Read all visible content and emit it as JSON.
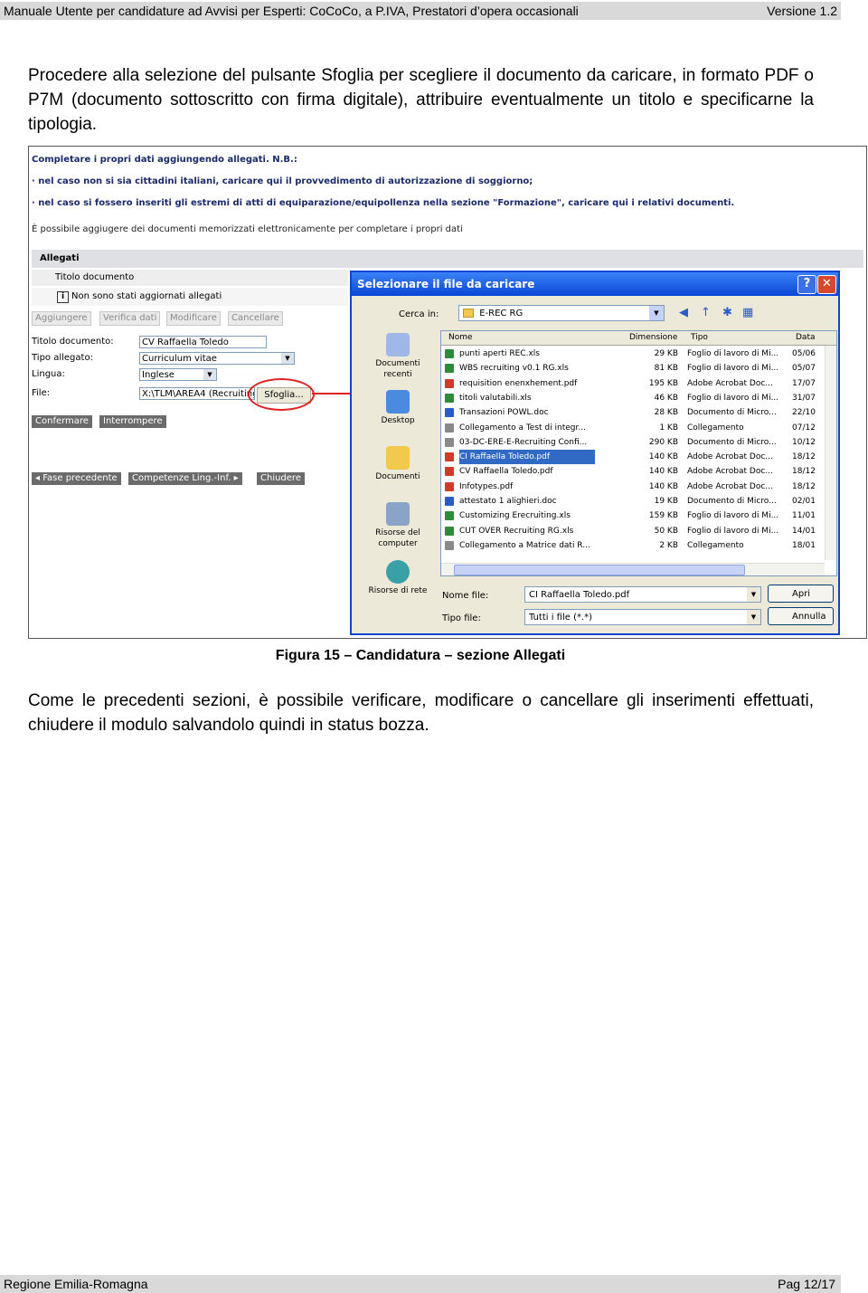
{
  "header": {
    "title": "Manuale Utente per candidature ad Avvisi per Esperti: CoCoCo, a P.IVA, Prestatori d’opera occasionali",
    "version": "Versione  1.2"
  },
  "intro_paragraph": "Procedere alla selezione del pulsante  Sfoglia  per scegliere il documento da caricare, in formato PDF o P7M (documento sottoscritto con firma digitale), attribuire eventualmente un titolo e specificarne la tipologia.",
  "figure": {
    "notes": {
      "line1": "Completare i propri dati aggiungendo allegati. N.B.:",
      "line2": "· nel caso non si sia cittadini italiani, caricare qui il provvedimento di autorizzazione di soggiorno;",
      "line3": "· nel caso si fossero inseriti gli estremi di atti di equiparazione/equipollenza nella sezione \"Formazione\", caricare qui i relativi documenti.",
      "line4": "È possibile aggiugere dei documenti memorizzati elettronicamente per completare i propri dati"
    },
    "section_title": "Allegati",
    "column_title": "Titolo documento",
    "info_message": "Non sono stati aggiornati allegati",
    "action_buttons": {
      "add": "Aggiungere",
      "verify": "Verifica dati",
      "modify": "Modificare",
      "delete": "Cancellare"
    },
    "form": {
      "title_label": "Titolo documento:",
      "title_value": "CV Raffaella Toledo",
      "type_label": "Tipo allegato:",
      "type_value": "Curriculum vitae",
      "language_label": "Lingua:",
      "language_value": "Inglese",
      "file_label": "File:",
      "file_value": "X:\\TLM\\AREA4 (Recruiting",
      "browse_button": "Sfoglia..."
    },
    "confirm_button": "Confermare",
    "interrupt_button": "Interrompere",
    "nav": {
      "prev": "Fase precedente",
      "next": "Competenze Ling.-Inf.",
      "close": "Chiudere"
    },
    "dialog": {
      "title": "Selezionare il file da caricare",
      "lookin_label": "Cerca in:",
      "lookin_value": "E-REC RG",
      "places": {
        "recent": "Documenti recenti",
        "desktop": "Desktop",
        "documents": "Documenti",
        "computer": "Risorse del computer",
        "network": "Risorse di rete"
      },
      "columns": {
        "name": "Nome",
        "size": "Dimensione",
        "type": "Tipo",
        "date": "Data"
      },
      "files": [
        {
          "name": "punti aperti REC.xls",
          "size": "29 KB",
          "type": "Foglio di lavoro di Mi...",
          "date": "05/06"
        },
        {
          "name": "WBS recruiting v0.1 RG.xls",
          "size": "81 KB",
          "type": "Foglio di lavoro di Mi...",
          "date": "05/07"
        },
        {
          "name": "requisition enenxhement.pdf",
          "size": "195 KB",
          "type": "Adobe Acrobat Doc...",
          "date": "17/07"
        },
        {
          "name": "titoli valutabili.xls",
          "size": "46 KB",
          "type": "Foglio di lavoro di Mi...",
          "date": "31/07"
        },
        {
          "name": "Transazioni POWL.doc",
          "size": "28 KB",
          "type": "Documento di Micro...",
          "date": "22/10"
        },
        {
          "name": "Collegamento a Test di integr...",
          "size": "1 KB",
          "type": "Collegamento",
          "date": "07/12"
        },
        {
          "name": "03-DC-ERE-E-Recruiting Confi...",
          "size": "290 KB",
          "type": "Documento di Micro...",
          "date": "10/12"
        },
        {
          "name": "CI Raffaella Toledo.pdf",
          "size": "140 KB",
          "type": "Adobe Acrobat Doc...",
          "date": "18/12"
        },
        {
          "name": "CV Raffaella Toledo.pdf",
          "size": "140 KB",
          "type": "Adobe Acrobat Doc...",
          "date": "18/12"
        },
        {
          "name": "Infotypes.pdf",
          "size": "140 KB",
          "type": "Adobe Acrobat Doc...",
          "date": "18/12"
        },
        {
          "name": "attestato 1 alighieri.doc",
          "size": "19 KB",
          "type": "Documento di Micro...",
          "date": "02/01"
        },
        {
          "name": "Customizing Erecruiting.xls",
          "size": "159 KB",
          "type": "Foglio di lavoro di Mi...",
          "date": "11/01"
        },
        {
          "name": "CUT OVER Recruiting RG.xls",
          "size": "50 KB",
          "type": "Foglio di lavoro di Mi...",
          "date": "14/01"
        },
        {
          "name": "Collegamento a Matrice dati R...",
          "size": "2 KB",
          "type": "Collegamento",
          "date": "18/01"
        }
      ],
      "filename_label": "Nome file:",
      "filename_value": "CI Raffaella Toledo.pdf",
      "filetype_label": "Tipo file:",
      "filetype_value": "Tutti i file (*.*)",
      "open_button": "Apri",
      "cancel_button": "Annulla"
    }
  },
  "caption": "Figura 15 – Candidatura – sezione Allegati",
  "outro_paragraph": "Come le precedenti sezioni, è possibile verificare, modificare o cancellare gli inserimenti effettuati, chiudere il modulo salvandolo quindi in status bozza.",
  "footer": {
    "org": "Regione Emilia-Romagna",
    "page": "Pag 12/17"
  },
  "colors": {
    "accent": "#0a46d6",
    "highlight": "#e02020",
    "selection": "#316ac5"
  }
}
